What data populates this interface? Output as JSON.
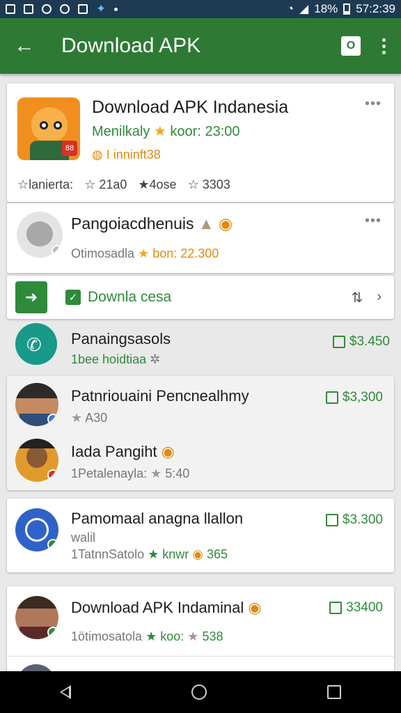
{
  "status_bar": {
    "battery": "18%",
    "time": "57:2:39"
  },
  "app_bar": {
    "title": "Download APK"
  },
  "featured": {
    "title": "Download APK Indanesia",
    "developer": "Menilkaly",
    "rating_text": "koor: 23:00",
    "price_text": "I inninft38",
    "stats": [
      "lanierta:",
      "21a0",
      "4ose",
      "3303"
    ]
  },
  "second": {
    "title": "Pangoiacdhenuis",
    "sub": "Otimosadla",
    "rating_text": "bon: 22.300"
  },
  "download_bar": {
    "label": "Downla cesa",
    "extra": "⇅"
  },
  "rows": [
    {
      "title": "Panaingsasols",
      "sub": "1bee hoidtiaa",
      "price": "$3.450"
    },
    {
      "title": "Patnriouaini Pencnealhmy",
      "sub": "A30",
      "price": "$3,300"
    },
    {
      "title": "Iada Pangiht",
      "sub": "1Petalenayla:",
      "rating": "5:40"
    },
    {
      "title": "Pamomaal anagna llallon",
      "sub2": "walil",
      "sub": "1TatnnSatolo",
      "rating_text": "knwr",
      "count": "365",
      "price": "$3.300"
    },
    {
      "title": "Download APK Indaminal",
      "sub": "1ötimosatola",
      "rating_text": "koo:",
      "count": "538",
      "price": "33400"
    }
  ],
  "colors": {
    "appbar": "#2e7a34",
    "accent": "#2e8b3a",
    "statusbar": "#1d3a52"
  }
}
